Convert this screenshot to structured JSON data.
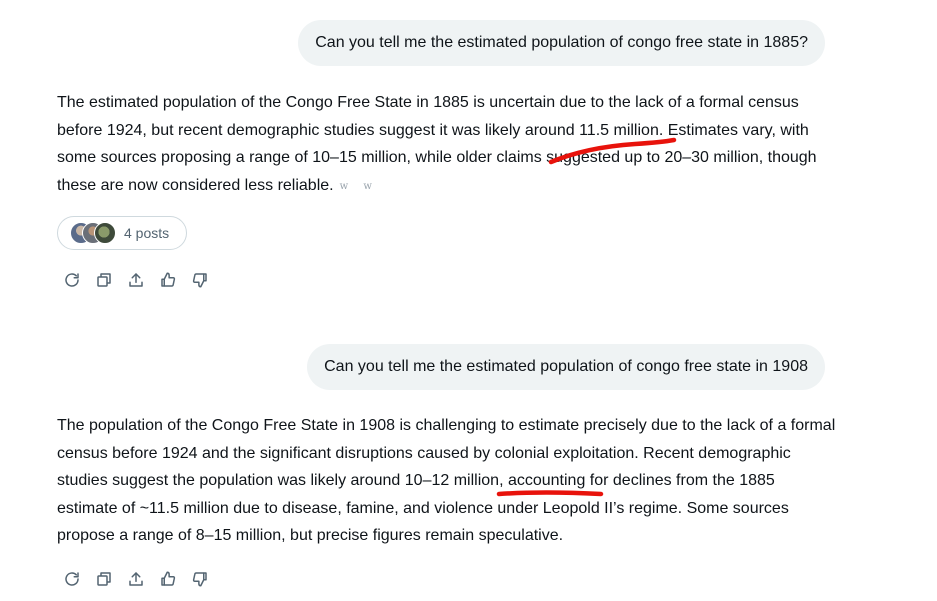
{
  "conversation": {
    "exchange1": {
      "question": "Can you tell me the estimated population of congo free state in 1885?",
      "answer": {
        "before": "The estimated population of the Congo Free State in 1885 is uncertain due to the lack of a formal census before 1924, but recent demographic studies suggest it was likely around ",
        "highlight": "11.5 million.",
        "after": " Estimates vary, with some sources proposing a range of 10–15 million, while older claims suggested up to 20–30 million, though these are now considered less reliable.",
        "citation_glyphs": "w w"
      },
      "sources": {
        "posts_label": "4 posts"
      }
    },
    "exchange2": {
      "question": "Can you tell me the estimated population of congo free state in 1908",
      "answer": {
        "before": "The population of the Congo Free State in 1908 is challenging to estimate precisely due to the lack of a formal census before 1924 and the significant disruptions caused by colonial exploitation. Recent demographic studies suggest the population was likely around ",
        "highlight": "10–12 million",
        "after": ", accounting for declines from the 1885 estimate of ~11.5 million due to disease, famine, and violence under Leopold II’s regime. Some sources propose a range of 8–15 million, but precise figures remain speculative."
      }
    }
  },
  "action_icons": [
    "regenerate-icon",
    "copy-icon",
    "share-icon",
    "thumbs-up-icon",
    "thumbs-down-icon"
  ],
  "colors": {
    "bubble_bg": "#eff3f4",
    "text": "#0f1419",
    "muted": "#536471",
    "annotation_red": "#e8130c"
  }
}
